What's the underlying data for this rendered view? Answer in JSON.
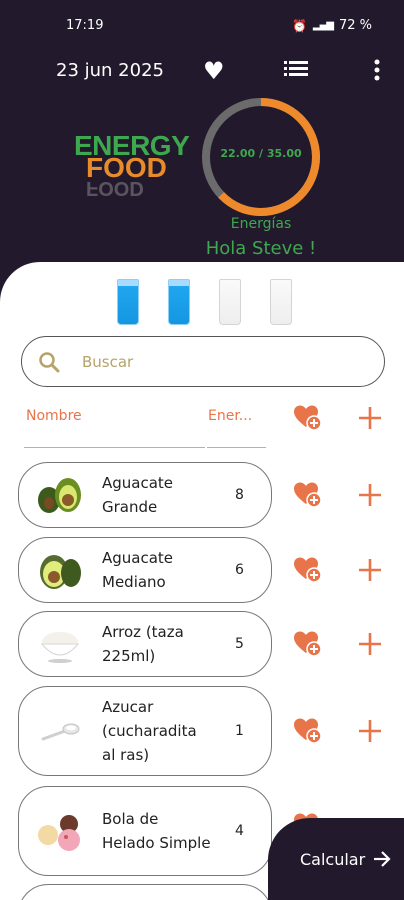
{
  "status_bar": {
    "time": "17:19",
    "network": "LTE",
    "battery": "72 %"
  },
  "header": {
    "date": "23 jun 2025"
  },
  "logo": {
    "line1": "ENERGY",
    "line2": "FOOD"
  },
  "gauge": {
    "text": "22.00 / 35.00",
    "consumed": 22,
    "total": 35,
    "track_color": "#6b6b6b",
    "fill_color": "#ef8a2c"
  },
  "energias_label": "Energías",
  "greeting": "Hola Steve !",
  "water": {
    "full": 2,
    "total": 4
  },
  "search": {
    "placeholder": "Buscar"
  },
  "columns": {
    "name": "Nombre",
    "energy": "Ener..."
  },
  "foods": [
    {
      "name": "Aguacate Grande",
      "energy": "8",
      "image": "avocado-icon"
    },
    {
      "name": "Aguacate Mediano",
      "energy": "6",
      "image": "avocado-half-icon"
    },
    {
      "name": "Arroz (taza 225ml)",
      "energy": "5",
      "image": "rice-bowl-icon"
    },
    {
      "name": "Azucar (cucharadita al ras)",
      "energy": "1",
      "image": "sugar-spoon-icon"
    },
    {
      "name": "Bola de Helado Simple",
      "energy": "4",
      "image": "ice-cream-icon"
    }
  ],
  "calc_button": {
    "label": "Calcular"
  },
  "colors": {
    "dark": "#221a2c",
    "green": "#3ea84f",
    "orange": "#e8744a"
  }
}
